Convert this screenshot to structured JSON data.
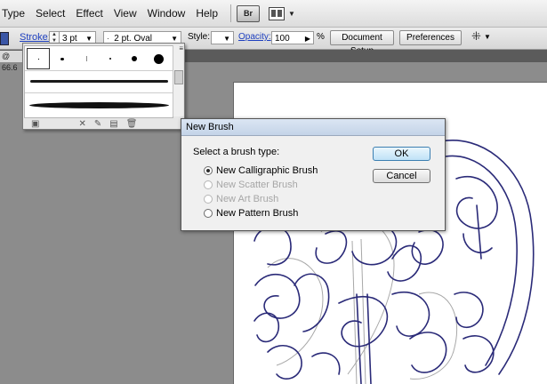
{
  "menu": [
    "Type",
    "Select",
    "Effect",
    "View",
    "Window",
    "Help"
  ],
  "bridge_icon_label": "Br",
  "control_bar": {
    "stroke_label": "Stroke:",
    "stroke_weight": "3 pt",
    "brush_label": "2 pt. Oval",
    "style_label": "Style:",
    "opacity_label": "Opacity:",
    "opacity_value": "100",
    "percent": "%",
    "document_setup": "Document Setup",
    "preferences": "Preferences"
  },
  "document_tab": "@ 66.6",
  "dialog": {
    "title": "New Brush",
    "prompt": "Select a brush type:",
    "options": [
      {
        "label": "New Calligraphic Brush",
        "selected": true,
        "enabled": true
      },
      {
        "label": "New Scatter Brush",
        "selected": false,
        "enabled": false
      },
      {
        "label": "New Art Brush",
        "selected": false,
        "enabled": false
      },
      {
        "label": "New Pattern Brush",
        "selected": false,
        "enabled": true
      }
    ],
    "ok": "OK",
    "cancel": "Cancel"
  },
  "colors": {
    "artwork_stroke": "#2a2a78",
    "sketch": "#9a9a9a",
    "fill_swatch": "#3a56a6"
  }
}
